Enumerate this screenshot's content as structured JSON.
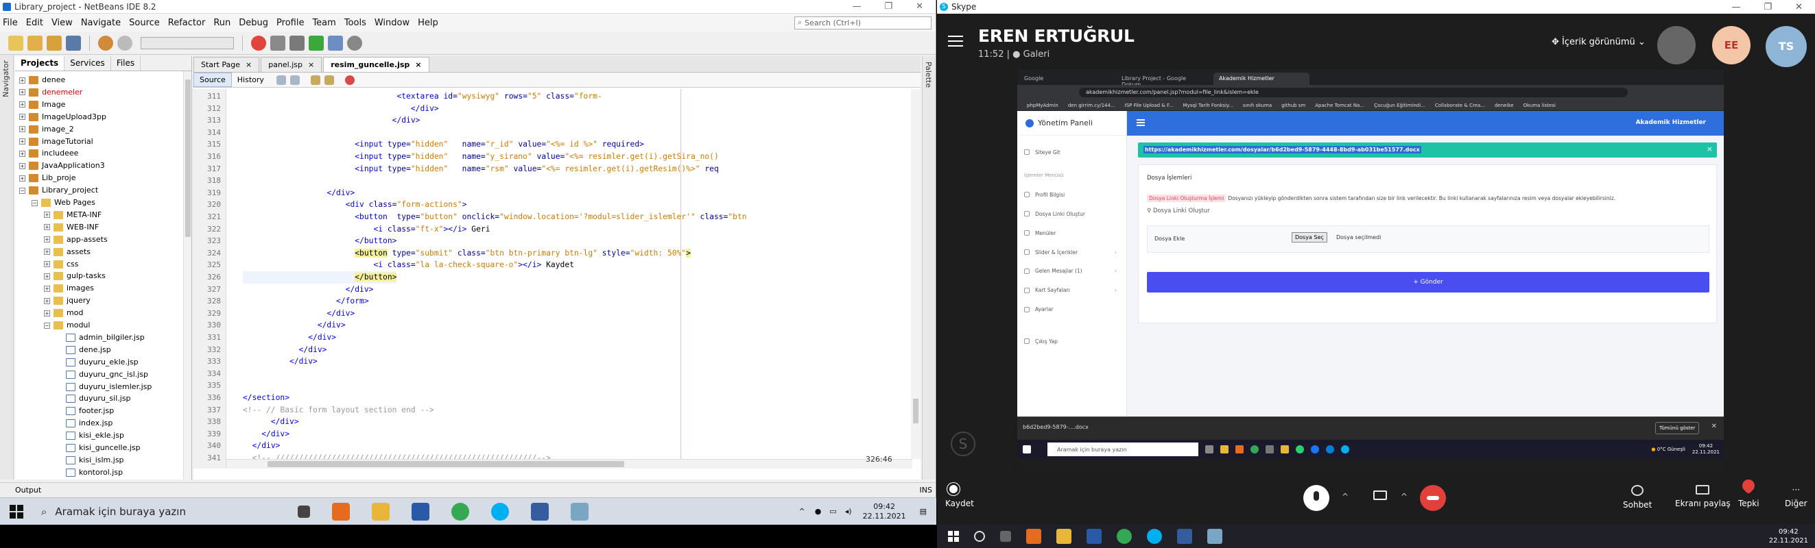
{
  "netbeans": {
    "window_title": "Library_project - NetBeans IDE 8.2",
    "menu": [
      "File",
      "Edit",
      "View",
      "Navigate",
      "Source",
      "Refactor",
      "Run",
      "Debug",
      "Profile",
      "Team",
      "Tools",
      "Window",
      "Help"
    ],
    "search_placeholder": "Search (Ctrl+I)",
    "side_labels": [
      "Navigator"
    ],
    "tree_tabs": [
      "Projects",
      "Services",
      "Files"
    ],
    "tree": [
      {
        "label": "denee",
        "depth": 0,
        "kind": "project",
        "toggle": "+"
      },
      {
        "label": "denemeler",
        "depth": 0,
        "kind": "project",
        "toggle": "+",
        "color": "red"
      },
      {
        "label": "Image",
        "depth": 0,
        "kind": "project",
        "toggle": "+"
      },
      {
        "label": "ImageUpload3pp",
        "depth": 0,
        "kind": "project",
        "toggle": "+"
      },
      {
        "label": "image_2",
        "depth": 0,
        "kind": "project",
        "toggle": "+"
      },
      {
        "label": "imageTutorial",
        "depth": 0,
        "kind": "project",
        "toggle": "+"
      },
      {
        "label": "includeee",
        "depth": 0,
        "kind": "project",
        "toggle": "+"
      },
      {
        "label": "JavaApplication3",
        "depth": 0,
        "kind": "project",
        "toggle": "+"
      },
      {
        "label": "Lib_proje",
        "depth": 0,
        "kind": "project",
        "toggle": "+"
      },
      {
        "label": "Library_project",
        "depth": 0,
        "kind": "project",
        "toggle": "−"
      },
      {
        "label": "Web Pages",
        "depth": 1,
        "kind": "folder",
        "toggle": "−"
      },
      {
        "label": "META-INF",
        "depth": 2,
        "kind": "folder",
        "toggle": "+"
      },
      {
        "label": "WEB-INF",
        "depth": 2,
        "kind": "folder",
        "toggle": "+"
      },
      {
        "label": "app-assets",
        "depth": 2,
        "kind": "folder",
        "toggle": "+"
      },
      {
        "label": "assets",
        "depth": 2,
        "kind": "folder",
        "toggle": "+"
      },
      {
        "label": "css",
        "depth": 2,
        "kind": "folder",
        "toggle": "+"
      },
      {
        "label": "gulp-tasks",
        "depth": 2,
        "kind": "folder",
        "toggle": "+"
      },
      {
        "label": "images",
        "depth": 2,
        "kind": "folder",
        "toggle": "+"
      },
      {
        "label": "jquery",
        "depth": 2,
        "kind": "folder",
        "toggle": "+"
      },
      {
        "label": "mod",
        "depth": 2,
        "kind": "folder",
        "toggle": "+"
      },
      {
        "label": "modul",
        "depth": 2,
        "kind": "folder",
        "toggle": "−"
      },
      {
        "label": "admin_bilgiler.jsp",
        "depth": 3,
        "kind": "file"
      },
      {
        "label": "dene.jsp",
        "depth": 3,
        "kind": "file"
      },
      {
        "label": "duyuru_ekle.jsp",
        "depth": 3,
        "kind": "file"
      },
      {
        "label": "duyuru_gnc_isl.jsp",
        "depth": 3,
        "kind": "file"
      },
      {
        "label": "duyuru_islemler.jsp",
        "depth": 3,
        "kind": "file"
      },
      {
        "label": "duyuru_sil.jsp",
        "depth": 3,
        "kind": "file"
      },
      {
        "label": "footer.jsp",
        "depth": 3,
        "kind": "file"
      },
      {
        "label": "index.jsp",
        "depth": 3,
        "kind": "file"
      },
      {
        "label": "kisi_ekle.jsp",
        "depth": 3,
        "kind": "file"
      },
      {
        "label": "kisi_guncelle.jsp",
        "depth": 3,
        "kind": "file"
      },
      {
        "label": "kisi_islm.jsp",
        "depth": 3,
        "kind": "file"
      },
      {
        "label": "kontorol.jsp",
        "depth": 3,
        "kind": "file"
      }
    ],
    "editor_tabs": [
      "Start Page",
      "panel.jsp",
      "resim_guncelle.jsp"
    ],
    "active_tab": "resim_guncelle.jsp",
    "views": [
      "Source",
      "History"
    ],
    "code_lines": [
      {
        "n": "311",
        "segs": [
          [
            "",
            "                                 "
          ],
          [
            "t",
            "<textarea"
          ],
          [
            "at",
            " id="
          ],
          [
            "sv2",
            "\"wysiwyg\""
          ],
          [
            "at",
            " rows="
          ],
          [
            "sv2",
            "\"5\""
          ],
          [
            "at",
            " class="
          ],
          [
            "sv2",
            "\"form-"
          ]
        ]
      },
      {
        "n": "312",
        "segs": [
          [
            "",
            "                                    "
          ],
          [
            "t",
            "</div>"
          ]
        ]
      },
      {
        "n": "313",
        "segs": [
          [
            "",
            "                                "
          ],
          [
            "t",
            "</div>"
          ]
        ]
      },
      {
        "n": "314",
        "segs": [
          [
            "",
            ""
          ]
        ]
      },
      {
        "n": "315",
        "segs": [
          [
            "",
            "                        "
          ],
          [
            "t",
            "<input"
          ],
          [
            "at",
            " type="
          ],
          [
            "sv2",
            "\"hidden\""
          ],
          [
            "at",
            "   name="
          ],
          [
            "sv2",
            "\"r_id\""
          ],
          [
            "at",
            " value="
          ],
          [
            "sv2",
            "\"<%= id %>\""
          ],
          [
            "at",
            " required"
          ],
          [
            "t",
            ">"
          ]
        ]
      },
      {
        "n": "316",
        "segs": [
          [
            "",
            "                        "
          ],
          [
            "t",
            "<input"
          ],
          [
            "at",
            " type="
          ],
          [
            "sv2",
            "\"hidden\""
          ],
          [
            "at",
            "   name="
          ],
          [
            "sv2",
            "\"y_sirano\""
          ],
          [
            "at",
            " value="
          ],
          [
            "sv2",
            "\"<%= resimler.get(i).getSira_no()"
          ]
        ]
      },
      {
        "n": "317",
        "segs": [
          [
            "",
            "                        "
          ],
          [
            "t",
            "<input"
          ],
          [
            "at",
            " type="
          ],
          [
            "sv2",
            "\"hidden\""
          ],
          [
            "at",
            "   name="
          ],
          [
            "sv2",
            "\"rsm\""
          ],
          [
            "at",
            " value="
          ],
          [
            "sv2",
            "\"<%= resimler.get(i).getResim()%>\""
          ],
          [
            "at",
            " req"
          ]
        ]
      },
      {
        "n": "318",
        "segs": [
          [
            "",
            ""
          ]
        ]
      },
      {
        "n": "319",
        "segs": [
          [
            "",
            "                  "
          ],
          [
            "t",
            "</div>"
          ]
        ]
      },
      {
        "n": "320",
        "segs": [
          [
            "",
            "                      "
          ],
          [
            "t",
            "<div"
          ],
          [
            "at",
            " class="
          ],
          [
            "sv2",
            "\"form-actions\""
          ],
          [
            "t",
            ">"
          ]
        ]
      },
      {
        "n": "321",
        "segs": [
          [
            "",
            "                        "
          ],
          [
            "t",
            "<button"
          ],
          [
            "at",
            "  type="
          ],
          [
            "sv2",
            "\"button\""
          ],
          [
            "at",
            " onclick="
          ],
          [
            "sv2",
            "\"window.location='?modul=slider_islemler'\""
          ],
          [
            "at",
            " class="
          ],
          [
            "sv2",
            "\"btn"
          ]
        ]
      },
      {
        "n": "322",
        "segs": [
          [
            "",
            "                            "
          ],
          [
            "t",
            "<i"
          ],
          [
            "at",
            " class="
          ],
          [
            "sv2",
            "\"ft-x\""
          ],
          [
            "t",
            "></i>"
          ],
          [
            "",
            " Geri"
          ]
        ]
      },
      {
        "n": "323",
        "segs": [
          [
            "",
            "                        "
          ],
          [
            "t",
            "</button>"
          ]
        ]
      },
      {
        "n": "324",
        "segs": [
          [
            "",
            "                        "
          ],
          [
            "bt",
            "<button"
          ],
          [
            "at",
            " type="
          ],
          [
            "sv2",
            "\"submit\""
          ],
          [
            "at",
            " class="
          ],
          [
            "sv2",
            "\"btn btn-primary btn-lg\""
          ],
          [
            "at",
            " style="
          ],
          [
            "sv2",
            "\"width: 50%\""
          ],
          [
            "bt",
            ">"
          ]
        ]
      },
      {
        "n": "325",
        "segs": [
          [
            "",
            "                            "
          ],
          [
            "t",
            "<i"
          ],
          [
            "at",
            " class="
          ],
          [
            "sv2",
            "\"la la-check-square-o\""
          ],
          [
            "t",
            "></i>"
          ],
          [
            "",
            " Kaydet"
          ]
        ]
      },
      {
        "n": "326",
        "segs": [
          [
            "",
            "                        "
          ],
          [
            "bt",
            "</button>"
          ]
        ],
        "hl": true
      },
      {
        "n": "327",
        "segs": [
          [
            "",
            "                      "
          ],
          [
            "t",
            "</div>"
          ]
        ]
      },
      {
        "n": "328",
        "segs": [
          [
            "",
            "                    "
          ],
          [
            "t",
            "</form>"
          ]
        ]
      },
      {
        "n": "329",
        "segs": [
          [
            "",
            "                  "
          ],
          [
            "t",
            "</div>"
          ]
        ]
      },
      {
        "n": "330",
        "segs": [
          [
            "",
            "                "
          ],
          [
            "t",
            "</div>"
          ]
        ]
      },
      {
        "n": "331",
        "segs": [
          [
            "",
            "              "
          ],
          [
            "t",
            "</div>"
          ]
        ]
      },
      {
        "n": "332",
        "segs": [
          [
            "",
            "            "
          ],
          [
            "t",
            "</div>"
          ]
        ]
      },
      {
        "n": "333",
        "segs": [
          [
            "",
            "          "
          ],
          [
            "t",
            "</div>"
          ]
        ]
      },
      {
        "n": "334",
        "segs": [
          [
            "",
            ""
          ]
        ]
      },
      {
        "n": "335",
        "segs": [
          [
            "",
            ""
          ]
        ]
      },
      {
        "n": "336",
        "segs": [
          [
            "",
            ""
          ],
          [
            "t",
            "</section>"
          ]
        ]
      },
      {
        "n": "337",
        "segs": [
          [
            "",
            ""
          ],
          [
            "cm",
            "<!-- // Basic form layout section end -->"
          ]
        ]
      },
      {
        "n": "338",
        "segs": [
          [
            "",
            "      "
          ],
          [
            "t",
            "</div>"
          ]
        ]
      },
      {
        "n": "339",
        "segs": [
          [
            "",
            "    "
          ],
          [
            "t",
            "</div>"
          ]
        ]
      },
      {
        "n": "340",
        "segs": [
          [
            "",
            "  "
          ],
          [
            "t",
            "</div>"
          ]
        ]
      },
      {
        "n": "341",
        "segs": [
          [
            "",
            "  "
          ],
          [
            "cm",
            "<!-- ////////////////////////////////////////////////////////-->"
          ]
        ]
      }
    ],
    "cursor_pos": "326:46",
    "ins_mode": "INS",
    "output_label": "Output",
    "palette_label": "Palette"
  },
  "left_taskbar": {
    "search_text": "Aramak için buraya yazın",
    "time": "09:42",
    "date": "22.11.2021"
  },
  "skype": {
    "window_title": "Skype",
    "caller_name": "EREN ERTUĞRUL",
    "caller_sub": "11:52 | ● Galeri",
    "view_label": "İçerik görünümü",
    "avatar1": "EE",
    "avatar2": "TS",
    "controls": {
      "camera_label": "Kaydet",
      "chat_label": "Sohbet",
      "share_label": "Ekranı paylaş",
      "react_label": "Tepki",
      "more_label": "Diğer"
    }
  },
  "shared_screen": {
    "tabs": [
      "Google",
      "Library Project - Google Dokum...",
      "Akademik Hizmetler"
    ],
    "url": "akademikhizmetler.com/panel.jsp?modul=file_link&islem=ekle",
    "bookmarks": [
      "phpMyAdmin",
      "den girrim.cy/144...",
      "ISP File Upload & F...",
      "Mysql Tarih Fonksiy...",
      "sınıfı okuma",
      "github sm",
      "Apache Tomcat Na...",
      "Çocuğun Eğitimindi...",
      "Collaborate & Crea...",
      "deneike",
      "Okuma listesi"
    ],
    "admin": {
      "logo_text": "Yönetim Paneli",
      "brand": "Akademik Hizmetler",
      "sidebar": [
        {
          "label": "Siteye Git",
          "kind": "item"
        },
        {
          "label": "İşlemler Menüsü",
          "kind": "group"
        },
        {
          "label": "Profil Bilgisi",
          "kind": "item"
        },
        {
          "label": "Dosya Linki Oluştur",
          "kind": "item"
        },
        {
          "label": "Menüler",
          "kind": "item"
        },
        {
          "label": "Slider & İçerikler",
          "kind": "item",
          "chev": true
        },
        {
          "label": "Gelen Mesajlar (1)",
          "kind": "item",
          "chev": true
        },
        {
          "label": "Kart Sayfaları",
          "kind": "item",
          "chev": true
        },
        {
          "label": "Ayarlar",
          "kind": "item"
        },
        {
          "label": "Çıkış Yap",
          "kind": "item"
        }
      ],
      "alert_url": "https://akademikhizmetler.com/dosyalar/b6d2bed9-5879-4448-8bd9-ab031be51577.docx",
      "card_title": "Dosya İşlemleri",
      "card_pill": "Dosya Linki Oluşturma İşlemi",
      "card_desc": "Dosyanızı yükleyip gönderdikten sonra sistem tarafından size bir link verilecektir. Bu linki kullanarak sayfalarınıza resim veya dosyalar ekleyebilirsiniz.",
      "card_link": "Dosya Linki Oluştur",
      "file_label": "Dosya Ekle",
      "file_button": "Dosya Seç",
      "file_value": "Dosya seçilmedi",
      "submit": "+ Gönder"
    },
    "download_file": "b6d2bed9-5879-....docx",
    "download_all": "Tümünü göster",
    "taskbar_search": "Aramak için buraya yazın",
    "weather": "0°C Güneşli",
    "time": "09:42",
    "date": "22.11.2021"
  },
  "right_taskbar": {
    "time": "09:42",
    "date": "22.11.2021"
  }
}
